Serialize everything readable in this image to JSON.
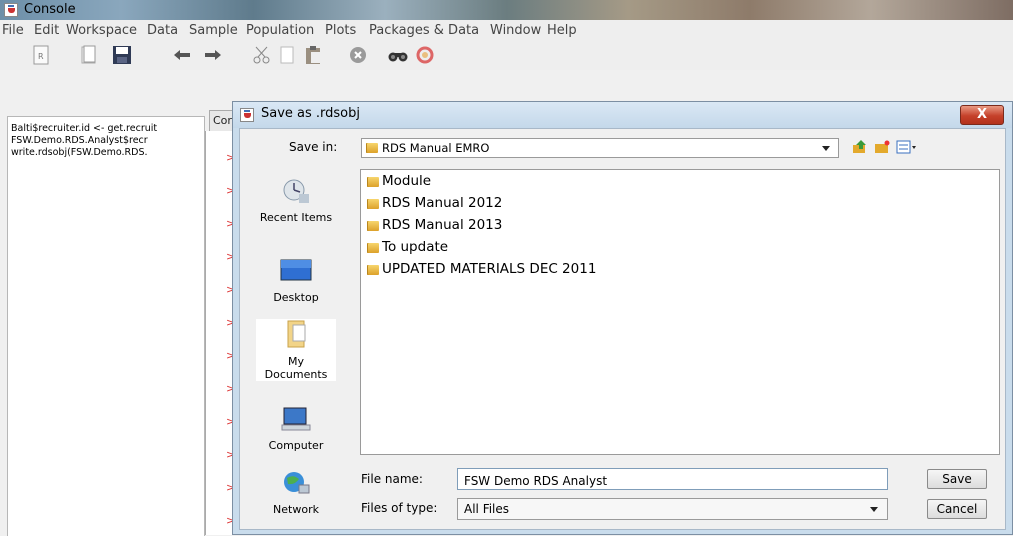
{
  "app": {
    "title": "Console"
  },
  "menu": [
    "File",
    "Edit",
    "Workspace",
    "Data",
    "Sample",
    "Population",
    "Plots",
    "Packages & Data",
    "Window",
    "Help"
  ],
  "toolbar": {
    "icons": [
      "new-script-icon",
      "open-file-icon",
      "save-icon",
      "undo-icon",
      "redo-icon",
      "cut-icon",
      "copy-icon",
      "paste-icon",
      "stop-icon",
      "find-icon",
      "help-icon"
    ]
  },
  "history": {
    "lines": [
      "Balti$recruiter.id <- get.recruit",
      "FSW.Demo.RDS.Analyst$recr",
      "write.rdsobj(FSW.Demo.RDS."
    ]
  },
  "console": {
    "tab_label": "Cor",
    "prompt": ">"
  },
  "dialog": {
    "title": "Save as .rdsobj",
    "close_label": "X",
    "save_in_label": "Save in:",
    "save_in_value": "RDS Manual EMRO",
    "places": [
      "Recent Items",
      "Desktop",
      "My Documents",
      "Computer",
      "Network"
    ],
    "files": [
      "Module",
      "RDS Manual 2012",
      "RDS Manual 2013",
      "To update",
      "UPDATED MATERIALS DEC 2011"
    ],
    "file_name_label": "File name:",
    "file_name_value": "FSW Demo RDS Analyst",
    "file_type_label": "Files of type:",
    "file_type_value": "All Files",
    "save_button": "Save",
    "cancel_button": "Cancel"
  },
  "colors": {
    "folder": "#e3a92c",
    "close_button": "#c5412a",
    "dialog_frame": "#c9dcec",
    "prompt": "#dd3333"
  }
}
